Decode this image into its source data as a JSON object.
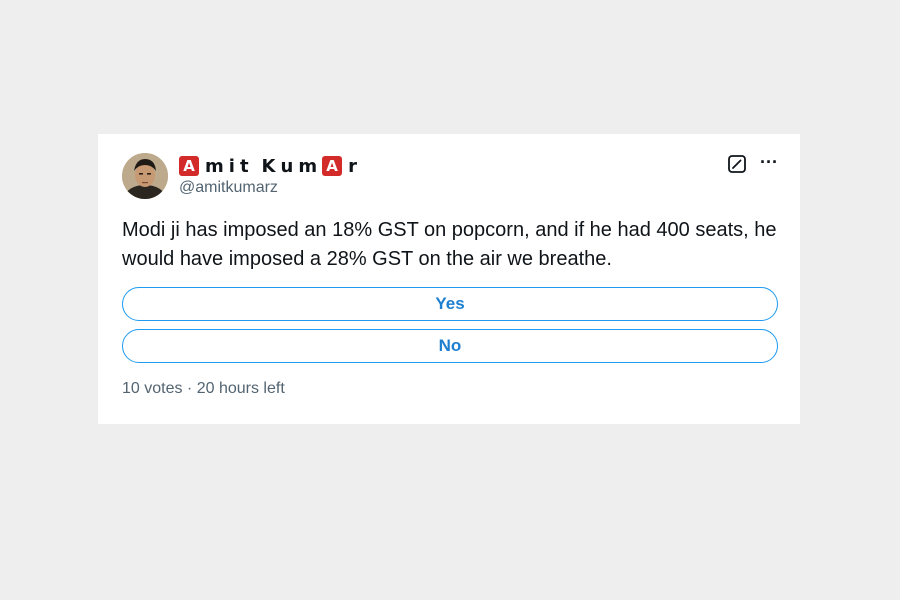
{
  "tweet": {
    "author": {
      "name_parts": [
        {
          "text": "A",
          "badge": true
        },
        {
          "text": "m",
          "badge": false
        },
        {
          "text": "i",
          "badge": false
        },
        {
          "text": "t",
          "badge": false
        },
        {
          "text": " ",
          "badge": false
        },
        {
          "text": "K",
          "badge": false
        },
        {
          "text": "u",
          "badge": false
        },
        {
          "text": "m",
          "badge": false
        },
        {
          "text": "A",
          "badge": true
        },
        {
          "text": "r",
          "badge": false
        }
      ],
      "handle": "@amitkumarz",
      "avatar_icon": "avatar-portrait"
    },
    "icons": {
      "edit": "edit-square-icon",
      "more": "more-dots-icon"
    },
    "text": "Modi ji has imposed an 18% GST on popcorn, and if he had 400 seats, he would have imposed a 28% GST on the air we breathe.",
    "poll": {
      "options": [
        "Yes",
        "No"
      ],
      "meta": "10 votes · 20 hours left"
    },
    "colors": {
      "accent": "#1d9bf0",
      "badge": "#d32a2a",
      "text": "#0f1419",
      "muted": "#536471"
    }
  }
}
